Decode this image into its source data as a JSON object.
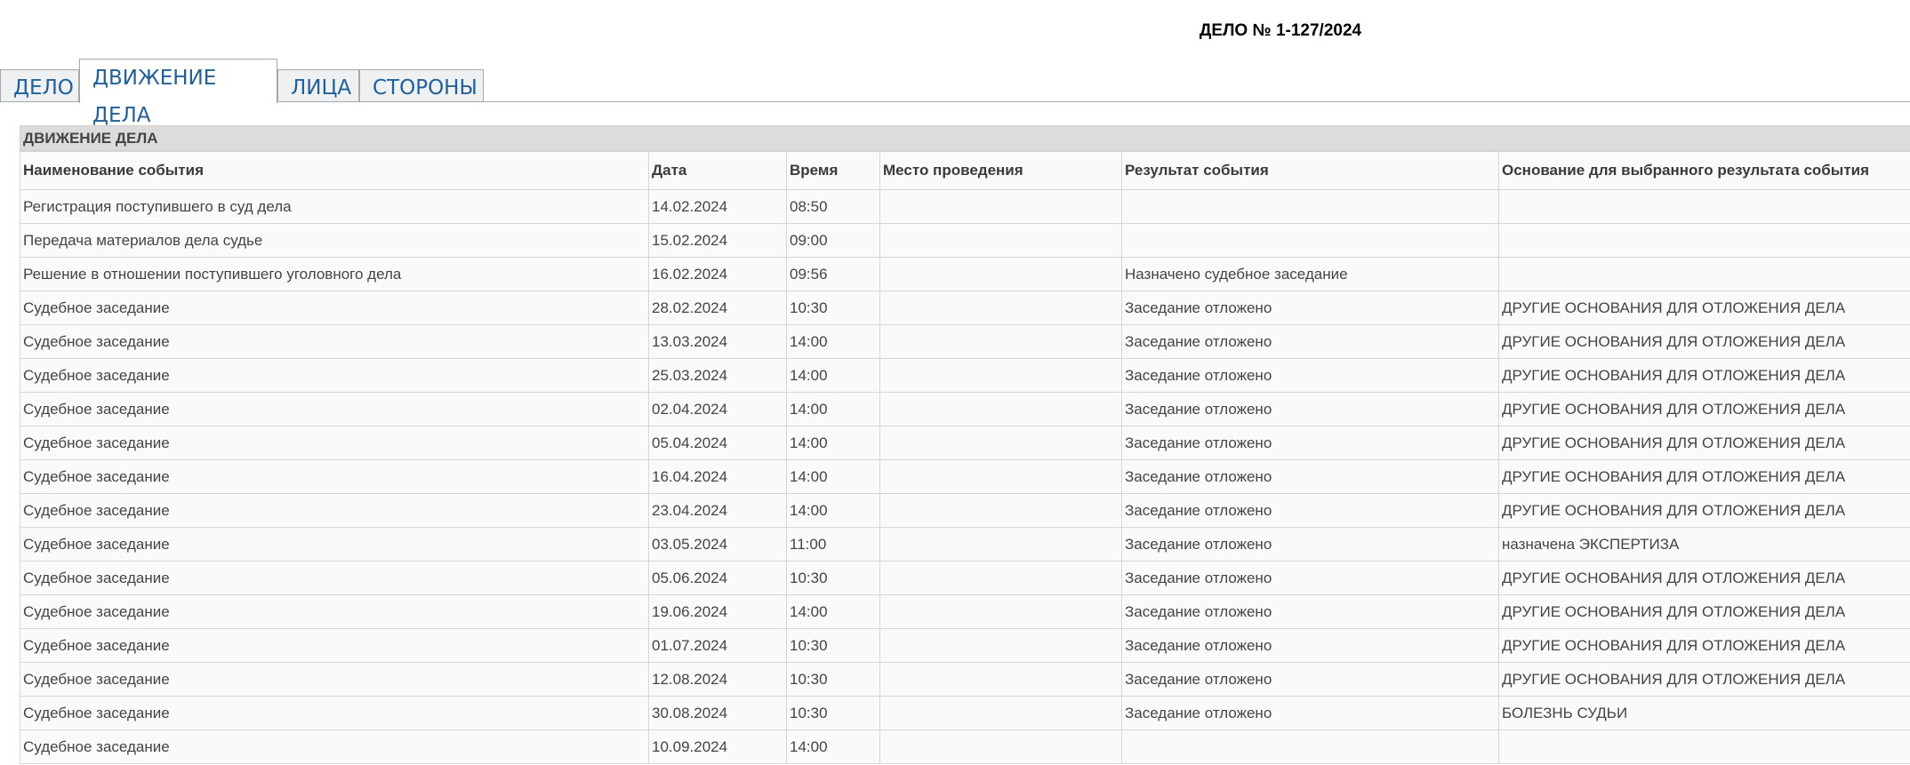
{
  "header": {
    "title": "ДЕЛО № 1-127/2024"
  },
  "tabs": [
    {
      "label": "ДЕЛО"
    },
    {
      "label": "ДВИЖЕНИЕ ДЕЛА",
      "active": true
    },
    {
      "label": "ЛИЦА"
    },
    {
      "label": "СТОРОНЫ"
    }
  ],
  "section": {
    "title": "ДВИЖЕНИЕ ДЕЛА"
  },
  "table": {
    "columns": [
      "Наименование события",
      "Дата",
      "Время",
      "Место проведения",
      "Результат события",
      "Основание для выбранного результата события"
    ],
    "rows": [
      [
        "Регистрация поступившего в суд дела",
        "14.02.2024",
        "08:50",
        "",
        "",
        ""
      ],
      [
        "Передача материалов дела судье",
        "15.02.2024",
        "09:00",
        "",
        "",
        ""
      ],
      [
        "Решение в отношении поступившего уголовного дела",
        "16.02.2024",
        "09:56",
        "",
        "Назначено судебное заседание",
        ""
      ],
      [
        "Судебное заседание",
        "28.02.2024",
        "10:30",
        "",
        "Заседание отложено",
        "ДРУГИЕ ОСНОВАНИЯ ДЛЯ ОТЛОЖЕНИЯ ДЕЛА"
      ],
      [
        "Судебное заседание",
        "13.03.2024",
        "14:00",
        "",
        "Заседание отложено",
        "ДРУГИЕ ОСНОВАНИЯ ДЛЯ ОТЛОЖЕНИЯ ДЕЛА"
      ],
      [
        "Судебное заседание",
        "25.03.2024",
        "14:00",
        "",
        "Заседание отложено",
        "ДРУГИЕ ОСНОВАНИЯ ДЛЯ ОТЛОЖЕНИЯ ДЕЛА"
      ],
      [
        "Судебное заседание",
        "02.04.2024",
        "14:00",
        "",
        "Заседание отложено",
        "ДРУГИЕ ОСНОВАНИЯ ДЛЯ ОТЛОЖЕНИЯ ДЕЛА"
      ],
      [
        "Судебное заседание",
        "05.04.2024",
        "14:00",
        "",
        "Заседание отложено",
        "ДРУГИЕ ОСНОВАНИЯ ДЛЯ ОТЛОЖЕНИЯ ДЕЛА"
      ],
      [
        "Судебное заседание",
        "16.04.2024",
        "14:00",
        "",
        "Заседание отложено",
        "ДРУГИЕ ОСНОВАНИЯ ДЛЯ ОТЛОЖЕНИЯ ДЕЛА"
      ],
      [
        "Судебное заседание",
        "23.04.2024",
        "14:00",
        "",
        "Заседание отложено",
        "ДРУГИЕ ОСНОВАНИЯ ДЛЯ ОТЛОЖЕНИЯ ДЕЛА"
      ],
      [
        "Судебное заседание",
        "03.05.2024",
        "11:00",
        "",
        "Заседание отложено",
        "назначена ЭКСПЕРТИЗА"
      ],
      [
        "Судебное заседание",
        "05.06.2024",
        "10:30",
        "",
        "Заседание отложено",
        "ДРУГИЕ ОСНОВАНИЯ ДЛЯ ОТЛОЖЕНИЯ ДЕЛА"
      ],
      [
        "Судебное заседание",
        "19.06.2024",
        "14:00",
        "",
        "Заседание отложено",
        "ДРУГИЕ ОСНОВАНИЯ ДЛЯ ОТЛОЖЕНИЯ ДЕЛА"
      ],
      [
        "Судебное заседание",
        "01.07.2024",
        "10:30",
        "",
        "Заседание отложено",
        "ДРУГИЕ ОСНОВАНИЯ ДЛЯ ОТЛОЖЕНИЯ ДЕЛА"
      ],
      [
        "Судебное заседание",
        "12.08.2024",
        "10:30",
        "",
        "Заседание отложено",
        "ДРУГИЕ ОСНОВАНИЯ ДЛЯ ОТЛОЖЕНИЯ ДЕЛА"
      ],
      [
        "Судебное заседание",
        "30.08.2024",
        "10:30",
        "",
        "Заседание отложено",
        "БОЛЕЗНЬ СУДЬИ"
      ],
      [
        "Судебное заседание",
        "10.09.2024",
        "14:00",
        "",
        "",
        ""
      ]
    ]
  },
  "colors": {
    "tab_text": "#1f5f9a",
    "section_header_bg": "#dcdcdc",
    "cell_bg": "#fafafa",
    "border": "#d6d6d6"
  }
}
